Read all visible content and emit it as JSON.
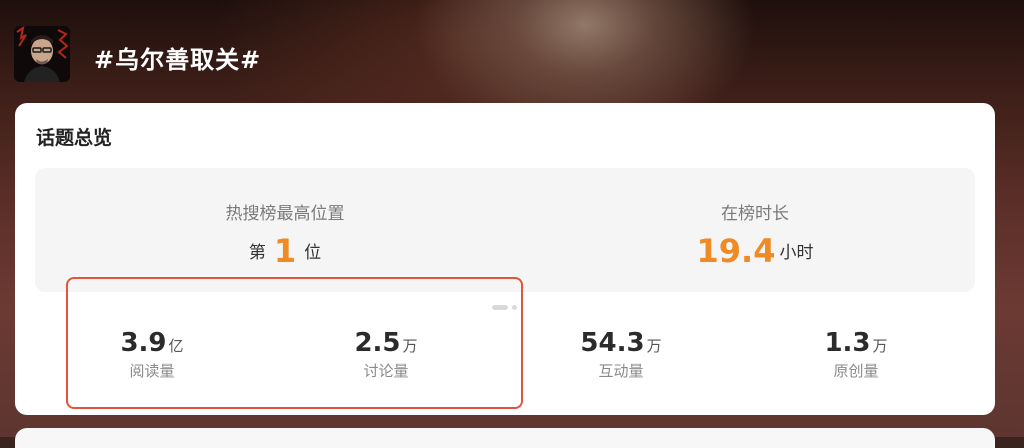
{
  "header": {
    "topic_title": "#乌尔善取关#"
  },
  "overview": {
    "title": "话题总览",
    "rank": {
      "label": "热搜榜最高位置",
      "prefix": "第",
      "value": "1",
      "suffix": "位"
    },
    "duration": {
      "label": "在榜时长",
      "value": "19.4",
      "unit": "小时"
    },
    "stats": [
      {
        "value": "3.9",
        "unit": "亿",
        "label": "阅读量"
      },
      {
        "value": "2.5",
        "unit": "万",
        "label": "讨论量"
      },
      {
        "value": "54.3",
        "unit": "万",
        "label": "互动量"
      },
      {
        "value": "1.3",
        "unit": "万",
        "label": "原创量"
      }
    ],
    "accent_color": "#f08a24",
    "highlight_color": "#e5533a"
  }
}
